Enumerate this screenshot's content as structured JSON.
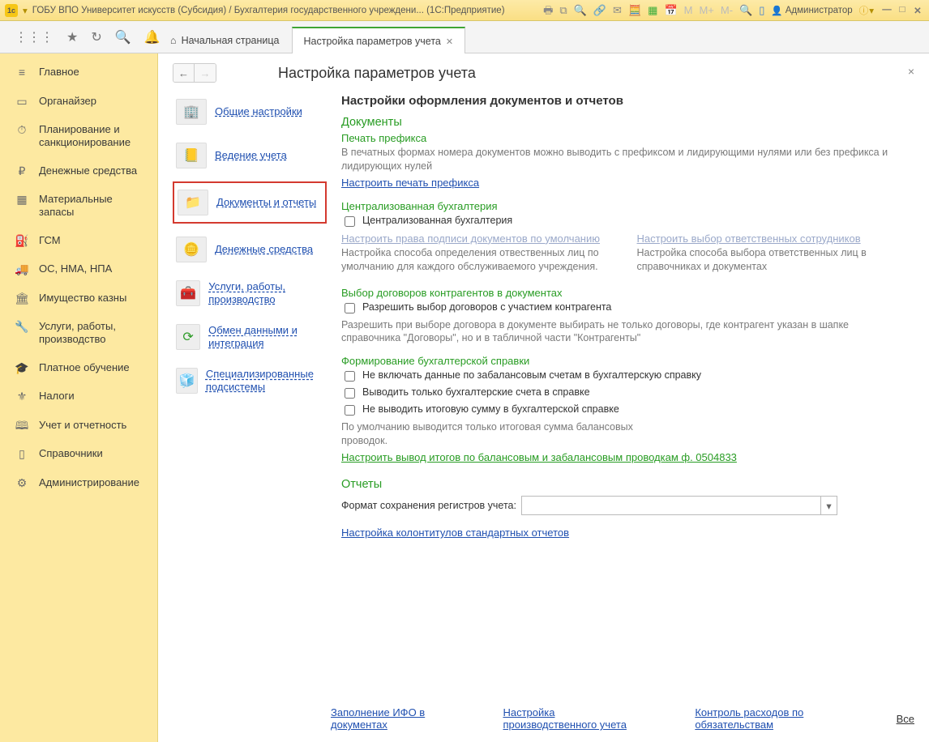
{
  "titlebar": {
    "title": "ГОБУ ВПО Университет искусств (Субсидия) / Бухгалтерия государственного учреждени...  (1С:Предприятие)",
    "user": "Администратор",
    "m_buttons": [
      "M",
      "M+",
      "M-"
    ]
  },
  "tabs": {
    "home": "Начальная страница",
    "active": "Настройка параметров учета"
  },
  "sidebar": {
    "items": [
      {
        "icon": "≡",
        "label": "Главное"
      },
      {
        "icon": "▭",
        "label": "Органайзер"
      },
      {
        "icon": "⏱",
        "label": "Планирование и санкционирование"
      },
      {
        "icon": "₽",
        "label": "Денежные средства"
      },
      {
        "icon": "▦",
        "label": "Материальные запасы"
      },
      {
        "icon": "⛽",
        "label": "ГСМ"
      },
      {
        "icon": "🚚",
        "label": "ОС, НМА, НПА"
      },
      {
        "icon": "🏛",
        "label": "Имущество казны"
      },
      {
        "icon": "🔧",
        "label": "Услуги, работы, производство"
      },
      {
        "icon": "🎓",
        "label": "Платное обучение"
      },
      {
        "icon": "⚜",
        "label": "Налоги"
      },
      {
        "icon": "🕮",
        "label": "Учет и отчетность"
      },
      {
        "icon": "▯",
        "label": "Справочники"
      },
      {
        "icon": "⚙",
        "label": "Администрирование"
      }
    ]
  },
  "page": {
    "title": "Настройка параметров учета",
    "close": "×",
    "back": "←",
    "fwd": "→"
  },
  "navlist": [
    {
      "label": "Общие настройки"
    },
    {
      "label": "Ведение учета"
    },
    {
      "label": "Документы и отчеты",
      "selected": true
    },
    {
      "label": "Денежные средства"
    },
    {
      "label": "Услуги, работы, производство"
    },
    {
      "label": "Обмен данными и интеграция"
    },
    {
      "label": "Специализированные подсистемы"
    }
  ],
  "settings": {
    "heading": "Настройки оформления документов и отчетов",
    "docs_h": "Документы",
    "prefix_h": "Печать префикса",
    "prefix_desc": "В печатных формах номера документов можно выводить с префиксом и лидирующими нулями или без префикса и лидирующих нулей",
    "prefix_link": "Настроить печать префикса",
    "central_h": "Централизованная бухгалтерия",
    "central_chk": "Централизованная бухгалтерия",
    "sign_link": "Настроить права подписи документов по умолчанию",
    "sign_desc": "Настройка способа определения отвественных лиц по умолчанию для каждого обслуживаемого учреждения.",
    "resp_link": "Настроить выбор ответственных сотрудников",
    "resp_desc": "Настройка способа выбора ответственных лиц в справочниках и документах",
    "contract_h": "Выбор договоров контрагентов в документах",
    "contract_chk": "Разрешить выбор договоров с участием контрагента",
    "contract_desc": "Разрешить при выборе договора в документе выбирать не только договоры, где контрагент указан в шапке справочника \"Договоры\", но и в табличной части \"Контрагенты\"",
    "ref_h": "Формирование бухгалтерской справки",
    "ref_chk1": "Не включать данные по забалансовым счетам в бухгалтерскую справку",
    "ref_chk2": "Выводить только бухгалтерские счета в справке",
    "ref_chk3": "Не выводить итоговую сумму в бухгалтерской справке",
    "ref_desc": "По умолчанию выводится только итоговая сумма балансовых проводок.",
    "ref_link": "Настроить вывод итогов по балансовым и забалансовым проводкам ф. 0504833",
    "reports_h": "Отчеты",
    "format_label": "Формат сохранения регистров учета:",
    "colont_link": "Настройка колонтитулов стандартных отчетов"
  },
  "footer": {
    "l1": "Заполнение ИФО в документах",
    "l2": "Настройка производственного учета",
    "l3": "Контроль расходов по обязательствам",
    "all": "Все"
  }
}
